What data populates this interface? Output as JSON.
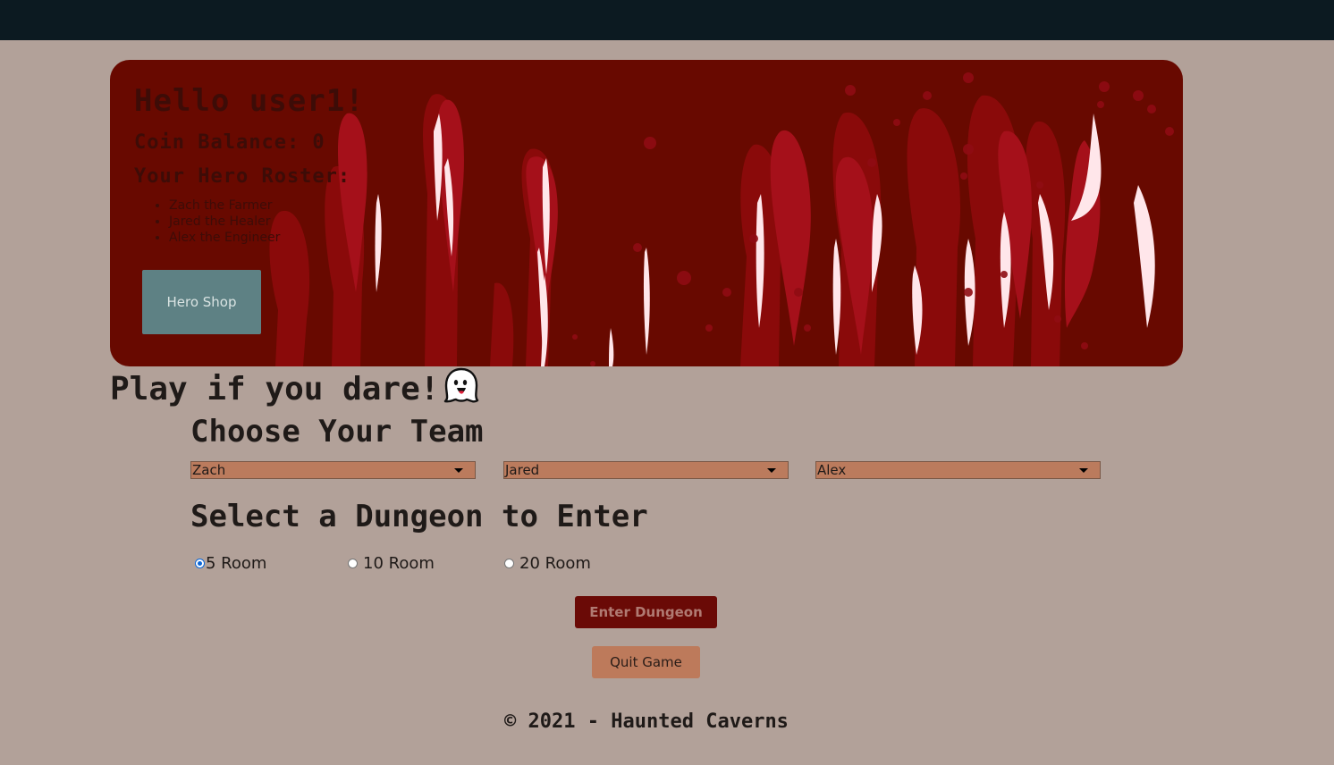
{
  "header": {},
  "banner": {
    "greeting": "Hello user1!",
    "coin_balance": "Coin Balance: 0",
    "roster_title": "Your Hero Roster:",
    "roster": [
      "Zach the Farmer",
      "Jared the Healer",
      "Alex the Engineer"
    ],
    "shop_button": "Hero Shop"
  },
  "play": {
    "title": "Play if you dare!",
    "icon": "ghost-icon"
  },
  "team": {
    "heading": "Choose Your Team",
    "selects": [
      "Zach",
      "Jared",
      "Alex"
    ]
  },
  "dungeon": {
    "heading": "Select a Dungeon to Enter",
    "options": [
      "5 Room",
      "10 Room",
      "20 Room"
    ],
    "selected": "5 Room"
  },
  "actions": {
    "enter": "Enter Dungeon",
    "quit": "Quit Game"
  },
  "footer": {
    "text": "© 2021 - Haunted Caverns"
  },
  "colors": {
    "topbar": "#0c1a21",
    "background": "#b2a199",
    "banner": "#680900",
    "shop_button": "#5e8184",
    "select_bg": "#bb7b5d",
    "enter_button": "#6a0a06",
    "quit_button": "#bd7a5b"
  }
}
